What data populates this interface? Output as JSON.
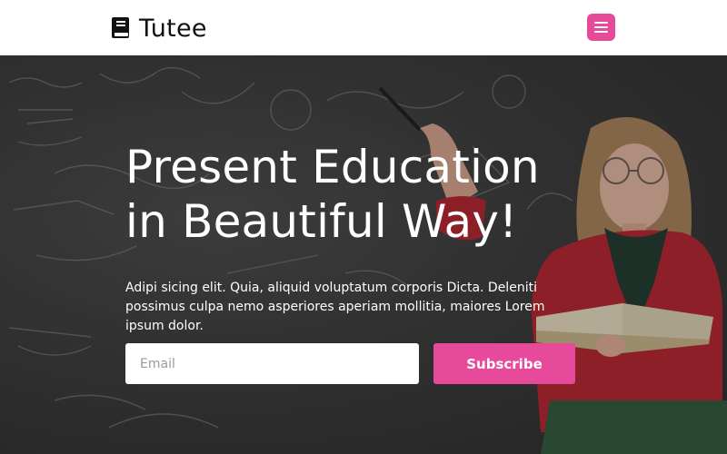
{
  "navbar": {
    "brand_name": "Tutee",
    "brand_icon": "book-icon",
    "menu_icon": "hamburger-icon"
  },
  "hero": {
    "title_line1": "Present Education",
    "title_line2": "in Beautiful Way!",
    "description": "Adipi sicing elit. Quia, aliquid voluptatum corporis Dicta. Deleniti possimus culpa nemo asperiores aperiam mollitia, maiores Lorem ipsum dolor.",
    "email_placeholder": "Email",
    "subscribe_label": "Subscribe"
  },
  "colors": {
    "accent": "#e7499b",
    "navbar_bg": "#ffffff",
    "hero_text": "#ffffff"
  }
}
